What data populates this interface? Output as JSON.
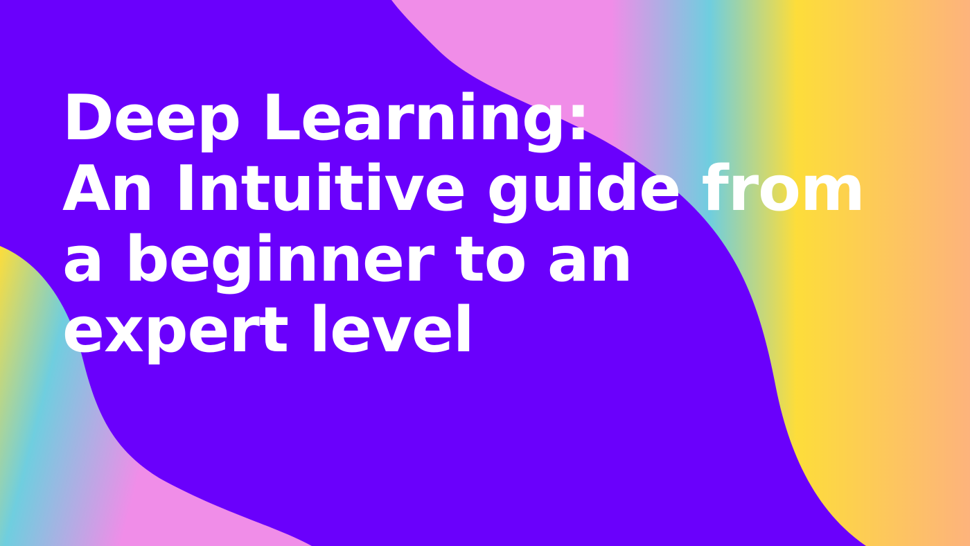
{
  "banner": {
    "background_color": "#6a00fc",
    "wave_colors": [
      "#f08de8",
      "#6fcedf",
      "#fddd3a",
      "#fdb37c"
    ],
    "title_lines": [
      "Deep Learning:",
      "An Intuitive guide from",
      "a beginner to an",
      "expert level"
    ],
    "title_color": "#ffffff"
  }
}
